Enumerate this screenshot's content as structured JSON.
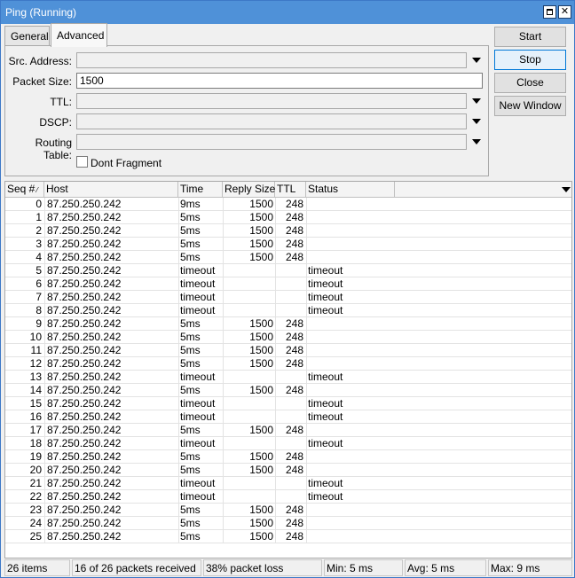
{
  "window": {
    "title": "Ping (Running)"
  },
  "tabs": [
    {
      "label": "General"
    },
    {
      "label": "Advanced"
    }
  ],
  "form": {
    "src_address": {
      "label": "Src. Address:",
      "value": ""
    },
    "packet_size": {
      "label": "Packet Size:",
      "value": "1500"
    },
    "ttl": {
      "label": "TTL:",
      "value": ""
    },
    "dscp": {
      "label": "DSCP:",
      "value": ""
    },
    "routing_table": {
      "label": "Routing Table:",
      "value": ""
    },
    "dont_fragment": {
      "label": "Dont Fragment",
      "checked": false
    }
  },
  "buttons": {
    "start": "Start",
    "stop": "Stop",
    "close": "Close",
    "new_window": "New Window"
  },
  "table": {
    "columns": [
      "Seq #",
      "Host",
      "Time",
      "Reply Size",
      "TTL",
      "Status"
    ],
    "rows": [
      {
        "seq": "0",
        "host": "87.250.250.242",
        "time": "9ms",
        "reply_size": "1500",
        "ttl": "248",
        "status": ""
      },
      {
        "seq": "1",
        "host": "87.250.250.242",
        "time": "5ms",
        "reply_size": "1500",
        "ttl": "248",
        "status": ""
      },
      {
        "seq": "2",
        "host": "87.250.250.242",
        "time": "5ms",
        "reply_size": "1500",
        "ttl": "248",
        "status": ""
      },
      {
        "seq": "3",
        "host": "87.250.250.242",
        "time": "5ms",
        "reply_size": "1500",
        "ttl": "248",
        "status": ""
      },
      {
        "seq": "4",
        "host": "87.250.250.242",
        "time": "5ms",
        "reply_size": "1500",
        "ttl": "248",
        "status": ""
      },
      {
        "seq": "5",
        "host": "87.250.250.242",
        "time": "timeout",
        "reply_size": "",
        "ttl": "",
        "status": "timeout"
      },
      {
        "seq": "6",
        "host": "87.250.250.242",
        "time": "timeout",
        "reply_size": "",
        "ttl": "",
        "status": "timeout"
      },
      {
        "seq": "7",
        "host": "87.250.250.242",
        "time": "timeout",
        "reply_size": "",
        "ttl": "",
        "status": "timeout"
      },
      {
        "seq": "8",
        "host": "87.250.250.242",
        "time": "timeout",
        "reply_size": "",
        "ttl": "",
        "status": "timeout"
      },
      {
        "seq": "9",
        "host": "87.250.250.242",
        "time": "5ms",
        "reply_size": "1500",
        "ttl": "248",
        "status": ""
      },
      {
        "seq": "10",
        "host": "87.250.250.242",
        "time": "5ms",
        "reply_size": "1500",
        "ttl": "248",
        "status": ""
      },
      {
        "seq": "11",
        "host": "87.250.250.242",
        "time": "5ms",
        "reply_size": "1500",
        "ttl": "248",
        "status": ""
      },
      {
        "seq": "12",
        "host": "87.250.250.242",
        "time": "5ms",
        "reply_size": "1500",
        "ttl": "248",
        "status": ""
      },
      {
        "seq": "13",
        "host": "87.250.250.242",
        "time": "timeout",
        "reply_size": "",
        "ttl": "",
        "status": "timeout"
      },
      {
        "seq": "14",
        "host": "87.250.250.242",
        "time": "5ms",
        "reply_size": "1500",
        "ttl": "248",
        "status": ""
      },
      {
        "seq": "15",
        "host": "87.250.250.242",
        "time": "timeout",
        "reply_size": "",
        "ttl": "",
        "status": "timeout"
      },
      {
        "seq": "16",
        "host": "87.250.250.242",
        "time": "timeout",
        "reply_size": "",
        "ttl": "",
        "status": "timeout"
      },
      {
        "seq": "17",
        "host": "87.250.250.242",
        "time": "5ms",
        "reply_size": "1500",
        "ttl": "248",
        "status": ""
      },
      {
        "seq": "18",
        "host": "87.250.250.242",
        "time": "timeout",
        "reply_size": "",
        "ttl": "",
        "status": "timeout"
      },
      {
        "seq": "19",
        "host": "87.250.250.242",
        "time": "5ms",
        "reply_size": "1500",
        "ttl": "248",
        "status": ""
      },
      {
        "seq": "20",
        "host": "87.250.250.242",
        "time": "5ms",
        "reply_size": "1500",
        "ttl": "248",
        "status": ""
      },
      {
        "seq": "21",
        "host": "87.250.250.242",
        "time": "timeout",
        "reply_size": "",
        "ttl": "",
        "status": "timeout"
      },
      {
        "seq": "22",
        "host": "87.250.250.242",
        "time": "timeout",
        "reply_size": "",
        "ttl": "",
        "status": "timeout"
      },
      {
        "seq": "23",
        "host": "87.250.250.242",
        "time": "5ms",
        "reply_size": "1500",
        "ttl": "248",
        "status": ""
      },
      {
        "seq": "24",
        "host": "87.250.250.242",
        "time": "5ms",
        "reply_size": "1500",
        "ttl": "248",
        "status": ""
      },
      {
        "seq": "25",
        "host": "87.250.250.242",
        "time": "5ms",
        "reply_size": "1500",
        "ttl": "248",
        "status": ""
      }
    ]
  },
  "statusbar": {
    "items": "26 items",
    "received": "16 of 26 packets received",
    "loss": "38% packet loss",
    "min": "Min: 5 ms",
    "avg": "Avg: 5 ms",
    "max": "Max: 9 ms"
  },
  "colors": {
    "titlebar": "#4f91d8",
    "focus_border": "#0078d7"
  }
}
